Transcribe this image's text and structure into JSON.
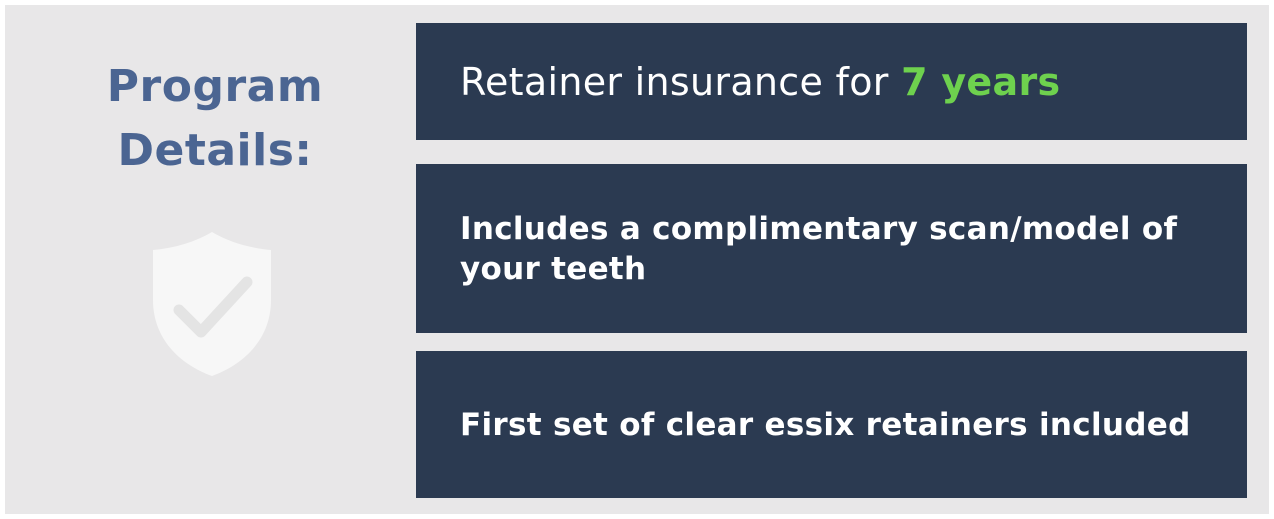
{
  "left": {
    "heading_line1": "Program",
    "heading_line2": "Details:",
    "icon": "shield-check-icon"
  },
  "cards": [
    {
      "text": "Retainer insurance for ",
      "highlight": "7 years"
    },
    {
      "text": "Includes a complimentary scan/model of your teeth"
    },
    {
      "text": "First set of clear essix retainers included"
    }
  ],
  "colors": {
    "background": "#e8e7e8",
    "heading": "#4b6592",
    "card": "#2b3a51",
    "card_text": "#ffffff",
    "highlight": "#6ed14e",
    "icon": "#f7f7f7"
  }
}
